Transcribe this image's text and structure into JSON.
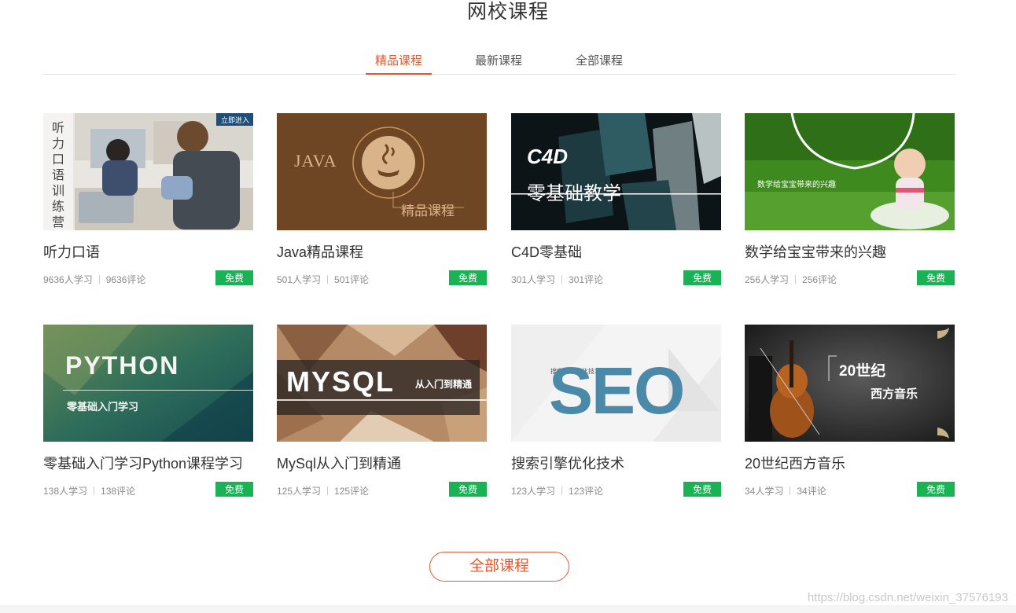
{
  "section": {
    "title": "网校课程"
  },
  "tabs": [
    {
      "label": "精品课程",
      "active": true
    },
    {
      "label": "最新课程",
      "active": false
    },
    {
      "label": "全部课程",
      "active": false
    }
  ],
  "courses": [
    {
      "title": "听力口语",
      "students": "9636人学习",
      "comments": "9636评论",
      "badge": "免费",
      "thumb": {
        "vertical_text": "听力口语训练营",
        "corner": "立即进入"
      }
    },
    {
      "title": "Java精品课程",
      "students": "501人学习",
      "comments": "501评论",
      "badge": "免费",
      "thumb": {
        "main": "JAVA",
        "sub": "精品课程"
      }
    },
    {
      "title": "C4D零基础",
      "students": "301人学习",
      "comments": "301评论",
      "badge": "免费",
      "thumb": {
        "main": "C4D",
        "sub": "零基础教学"
      }
    },
    {
      "title": "数学给宝宝带来的兴趣",
      "students": "256人学习",
      "comments": "256评论",
      "badge": "免费",
      "thumb": {
        "main": "数学给宝宝带来的兴趣"
      }
    },
    {
      "title": "零基础入门学习Python课程学习",
      "students": "138人学习",
      "comments": "138评论",
      "badge": "免费",
      "thumb": {
        "main": "PYTHON",
        "sub": "零基础入门学习"
      }
    },
    {
      "title": "MySql从入门到精通",
      "students": "125人学习",
      "comments": "125评论",
      "badge": "免费",
      "thumb": {
        "main": "MYSQL",
        "sub": "从入门到精通"
      }
    },
    {
      "title": "搜索引擎优化技术",
      "students": "123人学习",
      "comments": "123评论",
      "badge": "免费",
      "thumb": {
        "main": "SEO",
        "sub": "搜索引擎优化技术"
      }
    },
    {
      "title": "20世纪西方音乐",
      "students": "34人学习",
      "comments": "34评论",
      "badge": "免费",
      "thumb": {
        "main": "20世纪",
        "sub": "西方音乐"
      }
    }
  ],
  "more_button": {
    "label": "全部课程"
  },
  "watermark": "https://blog.csdn.net/weixin_37576193",
  "colors": {
    "accent": "#e4572e",
    "free_badge": "#19b356"
  }
}
